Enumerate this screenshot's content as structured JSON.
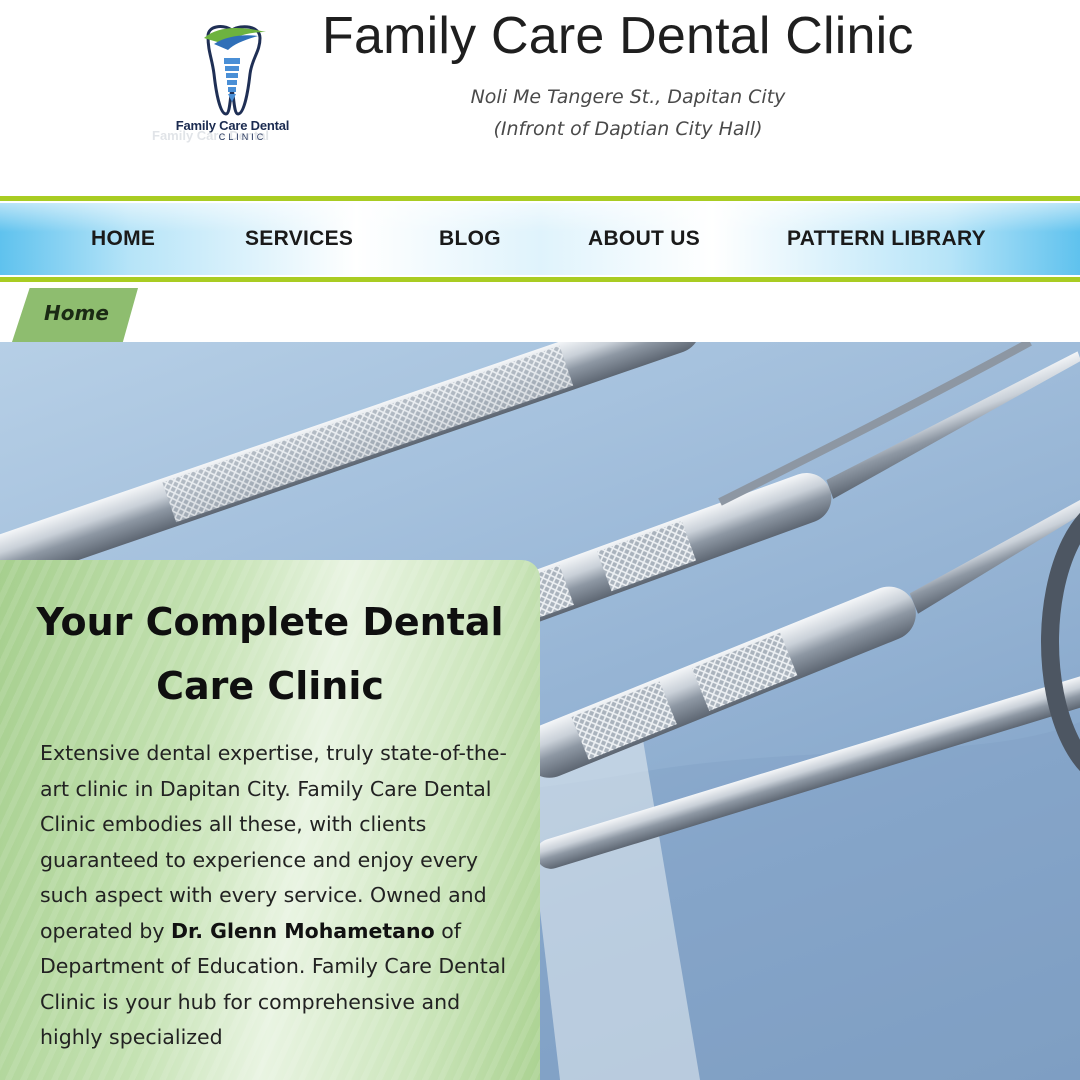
{
  "header": {
    "logo": {
      "name": "Family Care Dental",
      "sub": "CLINIC"
    },
    "title": "Family Care Dental Clinic",
    "address_line1": "Noli Me Tangere St., Dapitan City",
    "address_line2": "(Infront of Daptian City Hall)"
  },
  "nav": {
    "items": [
      {
        "label": "HOME"
      },
      {
        "label": "SERVICES"
      },
      {
        "label": "BLOG"
      },
      {
        "label": "ABOUT US"
      },
      {
        "label": "PATTERN LIBRARY"
      }
    ]
  },
  "breadcrumb": {
    "current": "Home"
  },
  "hero": {
    "heading": "Your Complete Dental Care Clinic",
    "body_part1": "Extensive dental expertise, truly state-of-the-art clinic in Dapitan City. Family Care Dental Clinic embodies all these, with clients guaranteed to experience and enjoy every such aspect with every service. Owned and operated by ",
    "body_bold": "Dr. Glenn Mohametano",
    "body_part2": " of Department of Education. Family Care Dental Clinic is your hub for comprehensive and highly specialized"
  },
  "colors": {
    "nav_border": "#a9cc22",
    "nav_sky": "#5fc2ee",
    "breadcrumb": "#8ebd6f",
    "card_green": "#a6cf8e",
    "hero_blue": "#9fbcda"
  },
  "icons": {
    "logo": "tooth-logo-icon"
  }
}
